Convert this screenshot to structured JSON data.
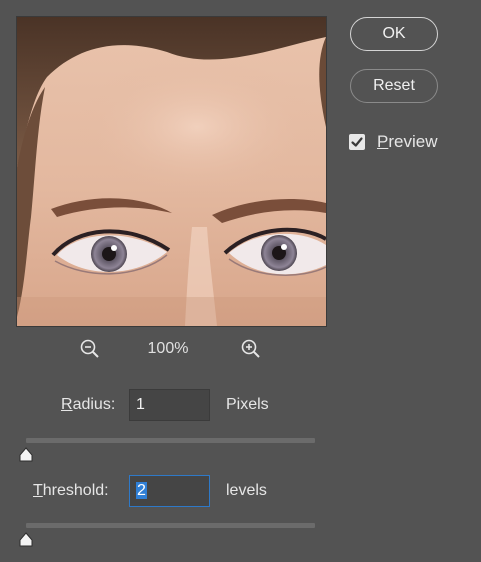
{
  "preview": {
    "zoom_level": "100%"
  },
  "buttons": {
    "ok_label": "OK",
    "reset_label": "Reset"
  },
  "preview_toggle": {
    "label_underlined": "P",
    "label_rest": "review",
    "checked": true
  },
  "radius": {
    "label_underlined": "R",
    "label_rest": "adius:",
    "value": "1",
    "unit": "Pixels",
    "slider_fraction": 0.0
  },
  "threshold": {
    "label_underlined": "T",
    "label_rest": "hreshold:",
    "value": "2",
    "unit": "levels",
    "slider_fraction": 0.0
  },
  "icons": {
    "zoom_out": "zoom-out-icon",
    "zoom_in": "zoom-in-icon",
    "checkmark": "checkmark-icon"
  },
  "colors": {
    "background": "#535353",
    "field_bg": "#454545",
    "focus_border": "#2e79c8",
    "selection": "#2f7fd6"
  }
}
